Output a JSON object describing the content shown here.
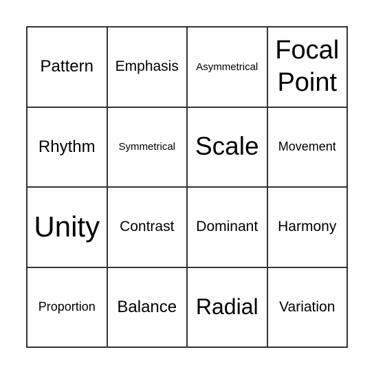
{
  "board": {
    "cells": [
      [
        "Pattern",
        "Emphasis",
        "Asymmetrical",
        "Focal Point"
      ],
      [
        "Rhythm",
        "Symmetrical",
        "Scale",
        "Movement"
      ],
      [
        "Unity",
        "Contrast",
        "Dominant",
        "Harmony"
      ],
      [
        "Proportion",
        "Balance",
        "Radial",
        "Variation"
      ]
    ]
  }
}
